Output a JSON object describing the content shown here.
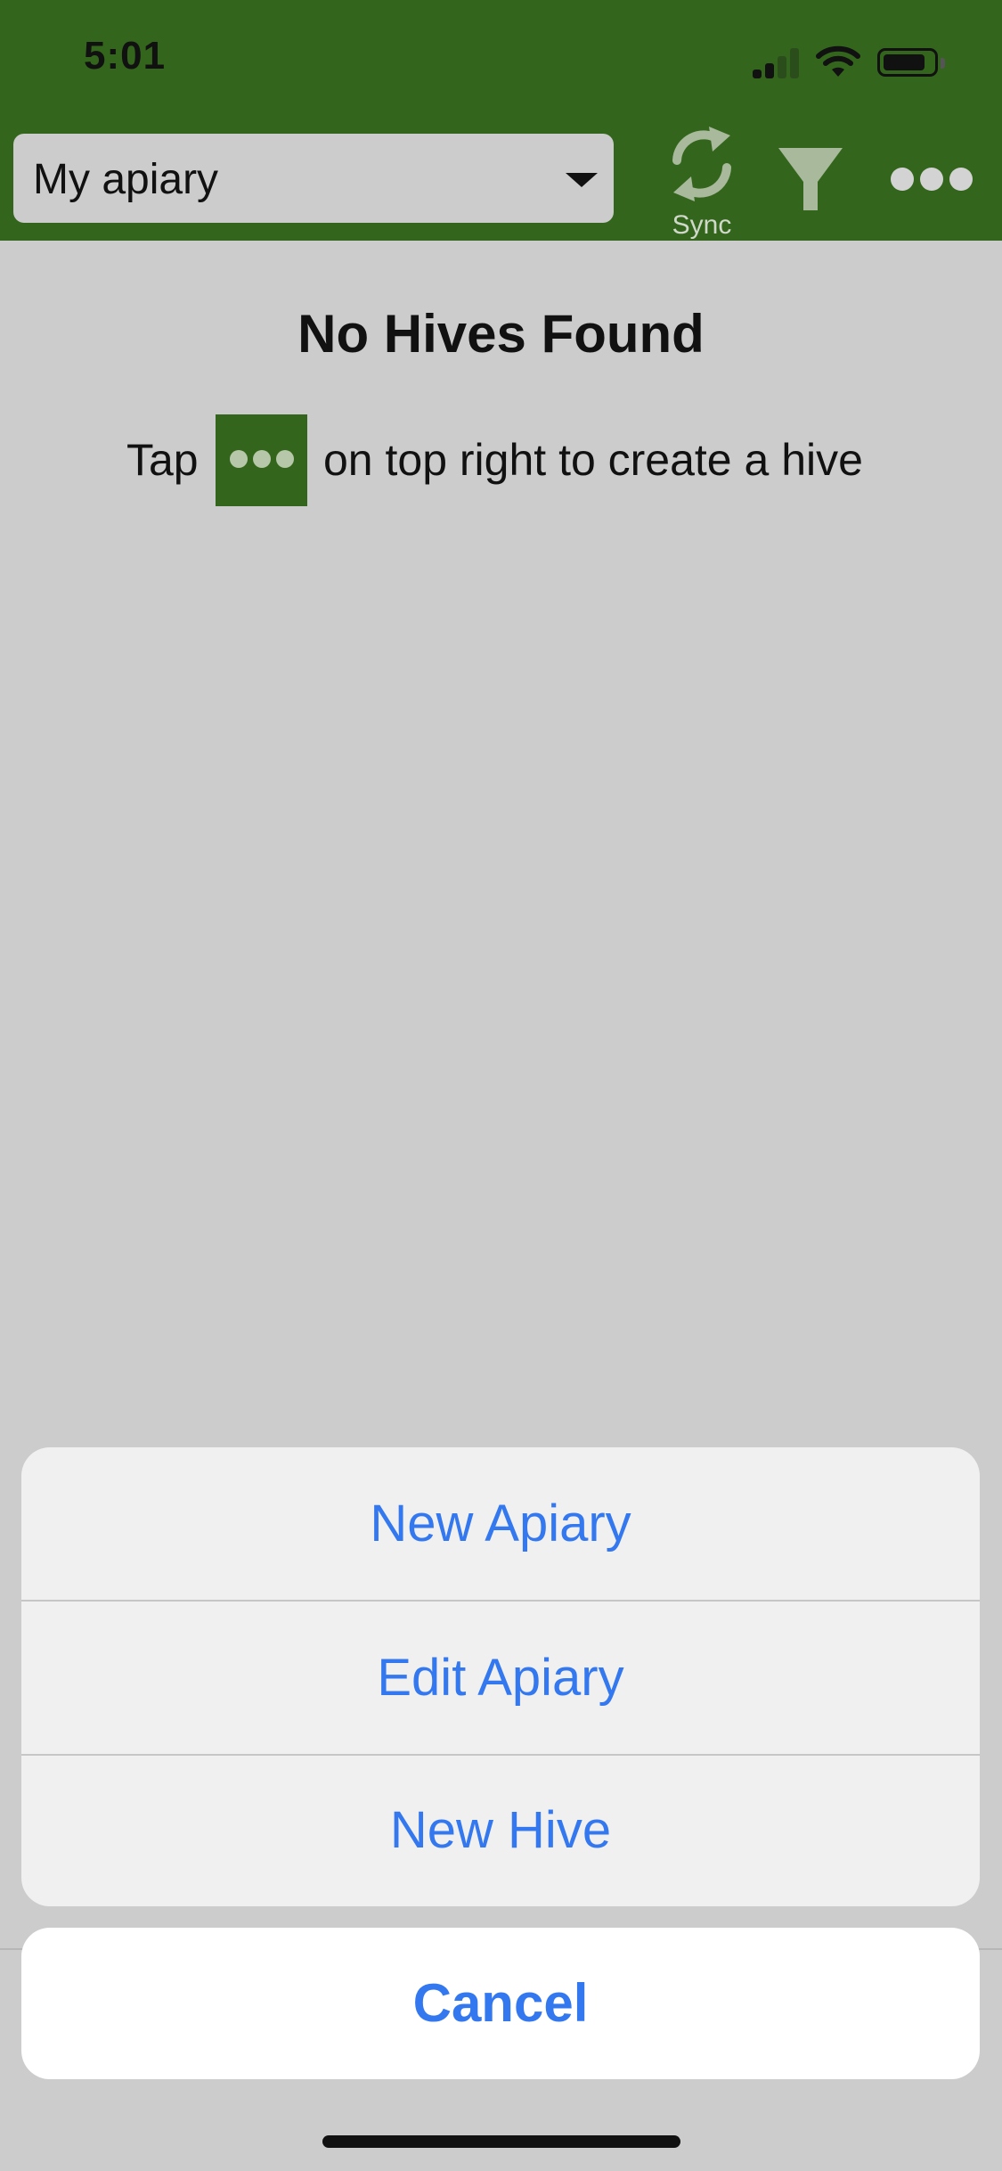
{
  "status_bar": {
    "time": "5:01",
    "signal_icon": "cellular-signal-icon",
    "wifi_icon": "wifi-icon",
    "battery_icon": "battery-icon"
  },
  "header": {
    "apiary_select": {
      "value": "My apiary"
    },
    "sync": {
      "label": "Sync",
      "icon": "sync-icon"
    },
    "filter": {
      "icon": "filter-icon"
    },
    "more": {
      "icon": "more-icon"
    },
    "colors": {
      "brand": "#33661c"
    }
  },
  "empty_state": {
    "title": "No Hives Found",
    "hint_prefix": "Tap",
    "hint_suffix": "on top right to create a hive",
    "hint_icon": "more-icon"
  },
  "action_sheet": {
    "items": [
      {
        "label": "New Apiary"
      },
      {
        "label": "Edit Apiary"
      },
      {
        "label": "New Hive"
      }
    ],
    "cancel_label": "Cancel",
    "accent_color": "#3478f0"
  }
}
